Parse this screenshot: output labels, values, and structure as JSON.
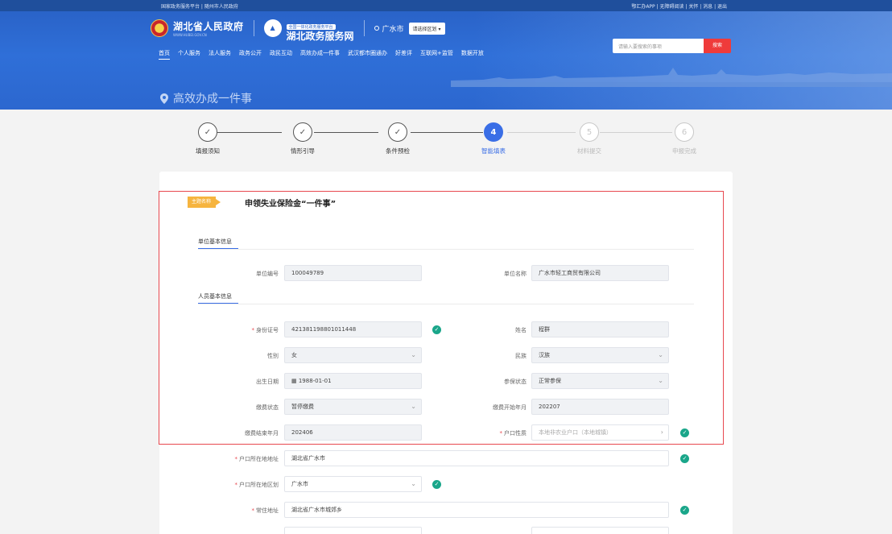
{
  "topbar": {
    "left": "国家政务服务平台 | 随州市人民政府",
    "right": "鄂汇办APP | 无障碍阅读 | 关怀 | 消息 | 退出"
  },
  "header": {
    "gov_name": "湖北省人民政府",
    "gov_url": "WWW.HUBEI.GOV.CN",
    "platform_tag": "全国一体化政务服务平台",
    "platform_name": "湖北政务服务网",
    "location": "广水市",
    "region_select": "请选择区划",
    "search_placeholder": "请输入要搜索的事项",
    "search_button": "搜索",
    "subtitle": "高效办成一件事"
  },
  "nav": [
    "首页",
    "个人服务",
    "法人服务",
    "政务公开",
    "政民互动",
    "高效办成一件事",
    "武汉都市圈通办",
    "好差评",
    "互联网+监管",
    "数据开放"
  ],
  "steps": [
    {
      "num": "✓",
      "label": "填报须知",
      "state": "done"
    },
    {
      "num": "✓",
      "label": "情形引导",
      "state": "done"
    },
    {
      "num": "✓",
      "label": "条件预检",
      "state": "done"
    },
    {
      "num": "4",
      "label": "智能填表",
      "state": "active"
    },
    {
      "num": "5",
      "label": "材料提交",
      "state": "todo"
    },
    {
      "num": "6",
      "label": "申报完成",
      "state": "todo"
    }
  ],
  "form": {
    "topic_tag": "主题名称",
    "topic_title": "申领失业保险金“一件事”",
    "unit_section": "单位基本信息",
    "person_section": "人员基本信息",
    "unit_id_label": "单位编号",
    "unit_id": "100049789",
    "unit_name_label": "单位名称",
    "unit_name": "广水市轻工商贸有限公司",
    "id_card_label": "身份证号",
    "id_card": "421381198801011448",
    "name_label": "姓名",
    "name": "程群",
    "gender_label": "性别",
    "gender": "女",
    "ethnic_label": "民族",
    "ethnic": "汉族",
    "birth_label": "出生日期",
    "birth": "1988-01-01",
    "insured_status_label": "参保状态",
    "insured_status": "正常参保",
    "pay_status_label": "缴费状态",
    "pay_status": "暂停缴费",
    "pay_start_label": "缴费开始年月",
    "pay_start": "202207",
    "pay_end_label": "缴费结束年月",
    "pay_end": "202406",
    "hukou_type_label": "户口性质",
    "hukou_type": "本地非农业户口（本地城镇）",
    "hukou_addr_label": "户口所在地地址",
    "hukou_addr": "湖北省广水市",
    "hukou_region_label": "户口所在地区划",
    "hukou_region": "广水市",
    "residence_label": "常住地址",
    "residence": "湖北省广水市城郊乡"
  }
}
